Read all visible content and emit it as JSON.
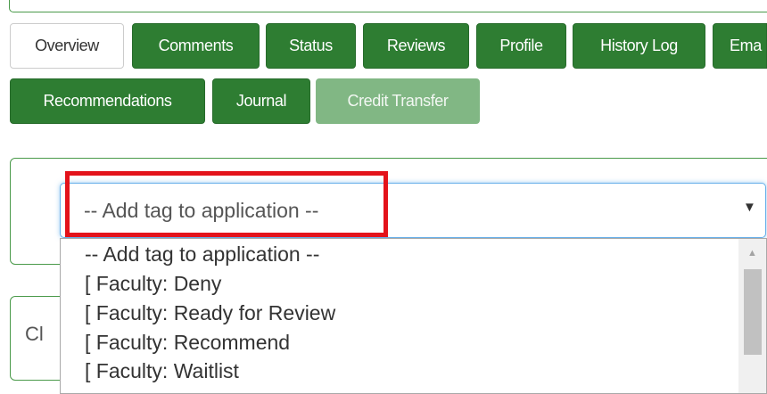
{
  "tabs": [
    {
      "label": "Overview",
      "state": "active"
    },
    {
      "label": "Comments",
      "state": "normal"
    },
    {
      "label": "Status",
      "state": "normal"
    },
    {
      "label": "Reviews",
      "state": "normal"
    },
    {
      "label": "Profile",
      "state": "normal"
    },
    {
      "label": "History Log",
      "state": "normal"
    },
    {
      "label": "Ema",
      "state": "normal"
    },
    {
      "label": "Recommendations",
      "state": "normal"
    },
    {
      "label": "Journal",
      "state": "normal"
    },
    {
      "label": "Credit Transfer",
      "state": "disabled"
    }
  ],
  "tag_select": {
    "selected": "-- Add tag to application --",
    "caret": "▼",
    "options": [
      "-- Add tag to application --",
      "[ Faculty: Deny",
      "[ Faculty: Ready for Review",
      "[ Faculty: Recommend",
      "[ Faculty: Waitlist"
    ]
  },
  "second_panel": {
    "text": "Cl"
  },
  "scrollbar": {
    "up_arrow": "▲"
  },
  "colors": {
    "tab_green": "#2e7d32",
    "tab_disabled": "#81b784",
    "highlight_red": "#e3131b",
    "focus_blue": "#66afe9"
  }
}
